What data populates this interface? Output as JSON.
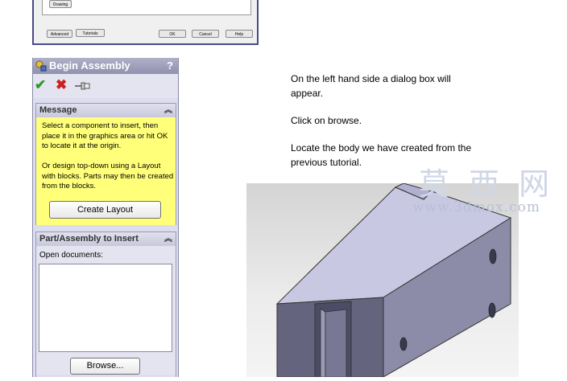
{
  "top_dialog": {
    "drawing_label": "Drawing",
    "advanced_label": "Advanced",
    "tutorials_label": "Tutorials",
    "ok_label": "OK",
    "cancel_label": "Cancel",
    "help_label": "Help"
  },
  "panel": {
    "title": "Begin Assembly",
    "help_icon": "?",
    "toolbar": {
      "ok_icon": "checkmark-icon",
      "cancel_icon": "x-icon",
      "pushpin_icon": "pushpin-icon"
    },
    "message_group": {
      "header": "Message",
      "text1": "Select a component to insert, then place it in the graphics area or hit OK to locate it at the origin.",
      "text2": "Or design top-down using a Layout with blocks. Parts may then be created from the blocks.",
      "create_layout_label": "Create Layout"
    },
    "part_group": {
      "header": "Part/Assembly to Insert",
      "open_documents_label": "Open documents:",
      "browse_label": "Browse..."
    }
  },
  "instructions": {
    "line1": "On the left hand side a dialog box will appear.",
    "line2": "Click on browse.",
    "line3": "Locate the body we have created from the previous tutorial."
  },
  "watermark": {
    "chars": "莫 西 网",
    "url": "www.3dmox.com"
  },
  "colors": {
    "message_bg": "#ffff7a",
    "panel_bg": "#ddddf0",
    "model_face": "#8c8ca8"
  }
}
